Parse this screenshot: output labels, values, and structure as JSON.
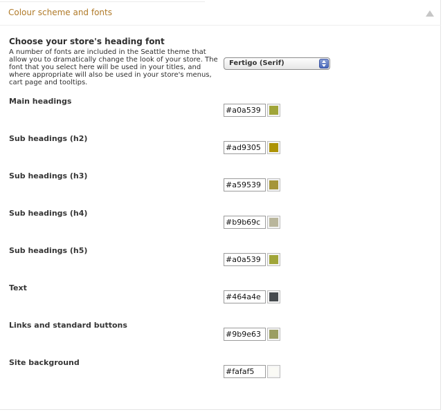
{
  "panel": {
    "title": "Colour scheme and fonts"
  },
  "font_section": {
    "heading": "Choose your store's heading font",
    "description": "A number of fonts are included in the Seattle theme that allow you to dramatically change the look of your store. The font that you select here will be used in your titles, and where appropriate will also be used in your store's menus, cart page and tooltips.",
    "selected_font": "Fertigo (Serif)"
  },
  "color_settings": [
    {
      "label": "Main headings",
      "value": "#a0a539",
      "swatch": "#a0a539"
    },
    {
      "label": "Sub headings (h2)",
      "value": "#ad9305",
      "swatch": "#ad9305"
    },
    {
      "label": "Sub headings (h3)",
      "value": "#a59539",
      "swatch": "#a59539"
    },
    {
      "label": "Sub headings (h4)",
      "value": "#b9b69c",
      "swatch": "#b9b69c"
    },
    {
      "label": "Sub headings (h5)",
      "value": "#a0a539",
      "swatch": "#a0a539"
    },
    {
      "label": "Text",
      "value": "#464a4e",
      "swatch": "#464a4e"
    },
    {
      "label": "Links and standard buttons",
      "value": "#9b9e63",
      "swatch": "#9b9e63"
    },
    {
      "label": "Site background",
      "value": "#fafaf5",
      "swatch": "#fafaf5"
    }
  ]
}
